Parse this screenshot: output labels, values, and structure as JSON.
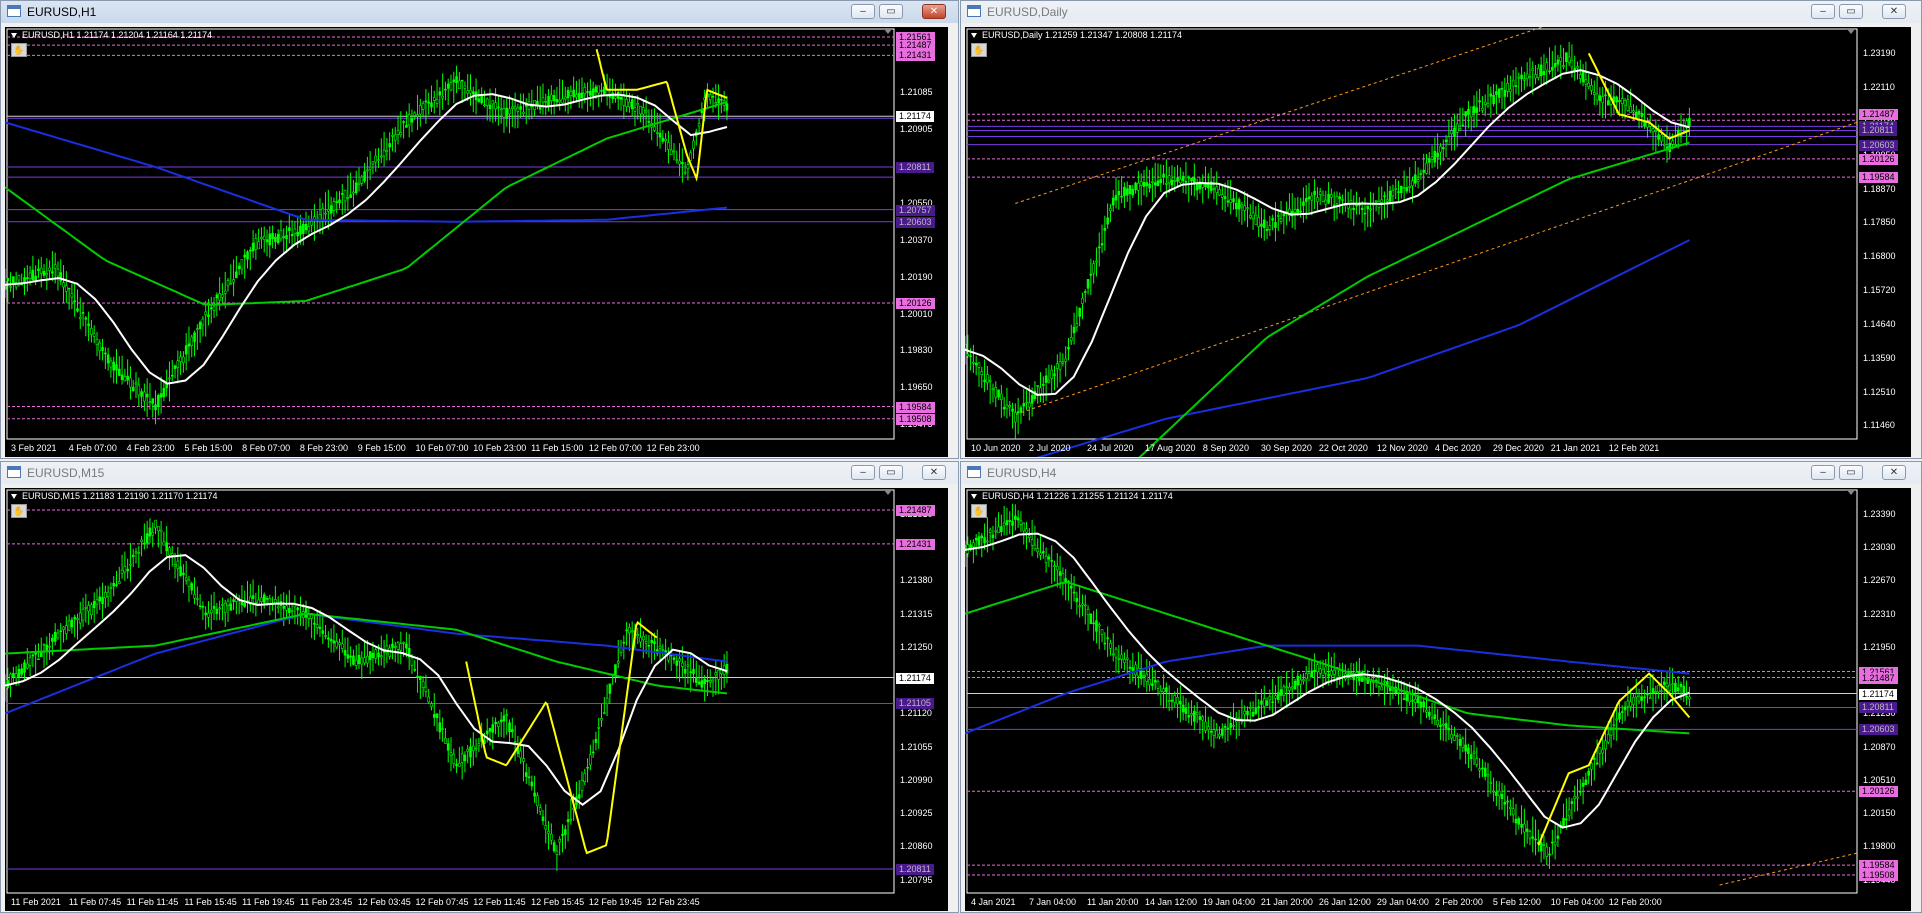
{
  "windows": [
    {
      "id": "h1",
      "title": "EURUSD,H1",
      "active": true,
      "chart_header": "EURUSD,H1  1.21174 1.21204 1.21164 1.21174",
      "price_axis": [
        "1.21260",
        "1.21085",
        "1.20905",
        "1.20725",
        "1.20550",
        "1.20370",
        "1.20190",
        "1.20010",
        "1.19830",
        "1.19650",
        "1.19475"
      ],
      "tags": [
        {
          "text": "1.21561",
          "kind": "pink"
        },
        {
          "text": "1.21487",
          "kind": "pink"
        },
        {
          "text": "1.21431",
          "kind": "pink"
        },
        {
          "text": "1.21174",
          "kind": "white"
        },
        {
          "text": "1.20811",
          "kind": "purple"
        },
        {
          "text": "1.20757",
          "kind": "purple"
        },
        {
          "text": "1.20603",
          "kind": "purple"
        },
        {
          "text": "1.20126",
          "kind": "pink"
        },
        {
          "text": "1.19584",
          "kind": "pink"
        },
        {
          "text": "1.19508",
          "kind": "pink"
        }
      ],
      "time_axis": [
        "3 Feb 2021",
        "4 Feb 07:00",
        "4 Feb 23:00",
        "5 Feb 15:00",
        "8 Feb 07:00",
        "8 Feb 23:00",
        "9 Feb 15:00",
        "10 Feb 07:00",
        "10 Feb 23:00",
        "11 Feb 15:00",
        "12 Feb 07:00",
        "12 Feb 23:00"
      ]
    },
    {
      "id": "daily",
      "title": "EURUSD,Daily",
      "active": false,
      "chart_header": "EURUSD,Daily  1.21259 1.21347 1.20808 1.21174",
      "price_axis": [
        "1.23190",
        "1.22110",
        "1.21030",
        "1.19950",
        "1.18870",
        "1.17850",
        "1.16800",
        "1.15720",
        "1.14640",
        "1.13590",
        "1.12510",
        "1.11460"
      ],
      "tags": [
        {
          "text": "1.21487",
          "kind": "pink"
        },
        {
          "text": "1.21174",
          "kind": "purple"
        },
        {
          "text": "1.20811",
          "kind": "purple"
        },
        {
          "text": "1.20603",
          "kind": "purple"
        },
        {
          "text": "1.20126",
          "kind": "pink"
        },
        {
          "text": "1.19584",
          "kind": "pink"
        }
      ],
      "time_axis": [
        "10 Jun 2020",
        "2 Jul 2020",
        "24 Jul 2020",
        "17 Aug 2020",
        "8 Sep 2020",
        "30 Sep 2020",
        "22 Oct 2020",
        "12 Nov 2020",
        "4 Dec 2020",
        "29 Dec 2020",
        "21 Jan 2021",
        "12 Feb 2021"
      ]
    },
    {
      "id": "m15",
      "title": "EURUSD,M15",
      "active": false,
      "chart_header": "EURUSD,M15  1.21183 1.21190 1.21170 1.21174",
      "price_axis": [
        "1.21510",
        "1.21445",
        "1.21380",
        "1.21315",
        "1.21250",
        "1.21185",
        "1.21120",
        "1.21055",
        "1.20990",
        "1.20925",
        "1.20860",
        "1.20795"
      ],
      "tags": [
        {
          "text": "1.21487",
          "kind": "pink"
        },
        {
          "text": "1.21431",
          "kind": "pink"
        },
        {
          "text": "1.21174",
          "kind": "white"
        },
        {
          "text": "1.21105",
          "kind": "purple"
        },
        {
          "text": "1.20811",
          "kind": "purple"
        }
      ],
      "time_axis": [
        "11 Feb 2021",
        "11 Feb 07:45",
        "11 Feb 11:45",
        "11 Feb 15:45",
        "11 Feb 19:45",
        "11 Feb 23:45",
        "12 Feb 03:45",
        "12 Feb 07:45",
        "12 Feb 11:45",
        "12 Feb 15:45",
        "12 Feb 19:45",
        "12 Feb 23:45"
      ]
    },
    {
      "id": "h4",
      "title": "EURUSD,H4",
      "active": false,
      "chart_header": "EURUSD,H4  1.21226 1.21255 1.21124 1.21174",
      "price_axis": [
        "1.23390",
        "1.23030",
        "1.22670",
        "1.22310",
        "1.21950",
        "1.21590",
        "1.21230",
        "1.20870",
        "1.20510",
        "1.20150",
        "1.19800",
        "1.19440"
      ],
      "tags": [
        {
          "text": "1.21561",
          "kind": "pink"
        },
        {
          "text": "1.21487",
          "kind": "pink"
        },
        {
          "text": "1.21174",
          "kind": "white"
        },
        {
          "text": "1.20811",
          "kind": "purple"
        },
        {
          "text": "1.20603",
          "kind": "purple"
        },
        {
          "text": "1.20126",
          "kind": "pink"
        },
        {
          "text": "1.19584",
          "kind": "pink"
        },
        {
          "text": "1.19508",
          "kind": "pink"
        }
      ],
      "time_axis": [
        "4 Jan 2021",
        "7 Jan 04:00",
        "11 Jan 20:00",
        "14 Jan 12:00",
        "19 Jan 04:00",
        "21 Jan 20:00",
        "26 Jan 12:00",
        "29 Jan 04:00",
        "2 Feb 20:00",
        "5 Feb 12:00",
        "10 Feb 04:00",
        "12 Feb 20:00"
      ]
    }
  ],
  "colors": {
    "chart_bg": "#000000",
    "candles": "#00ff00",
    "ma_fast": "#ffffff",
    "ma_mid": "#00cc00",
    "ma_slow": "#1a2fe0",
    "highlight": "#ffff00",
    "level_pink": "#e86ee0",
    "level_purple": "#7a3ce0",
    "channel": "#ff9a1a"
  },
  "icons": {
    "hand": "hand-scroll-icon",
    "minimize": "minimize-icon",
    "maximize": "maximize-icon",
    "close": "close-icon"
  }
}
